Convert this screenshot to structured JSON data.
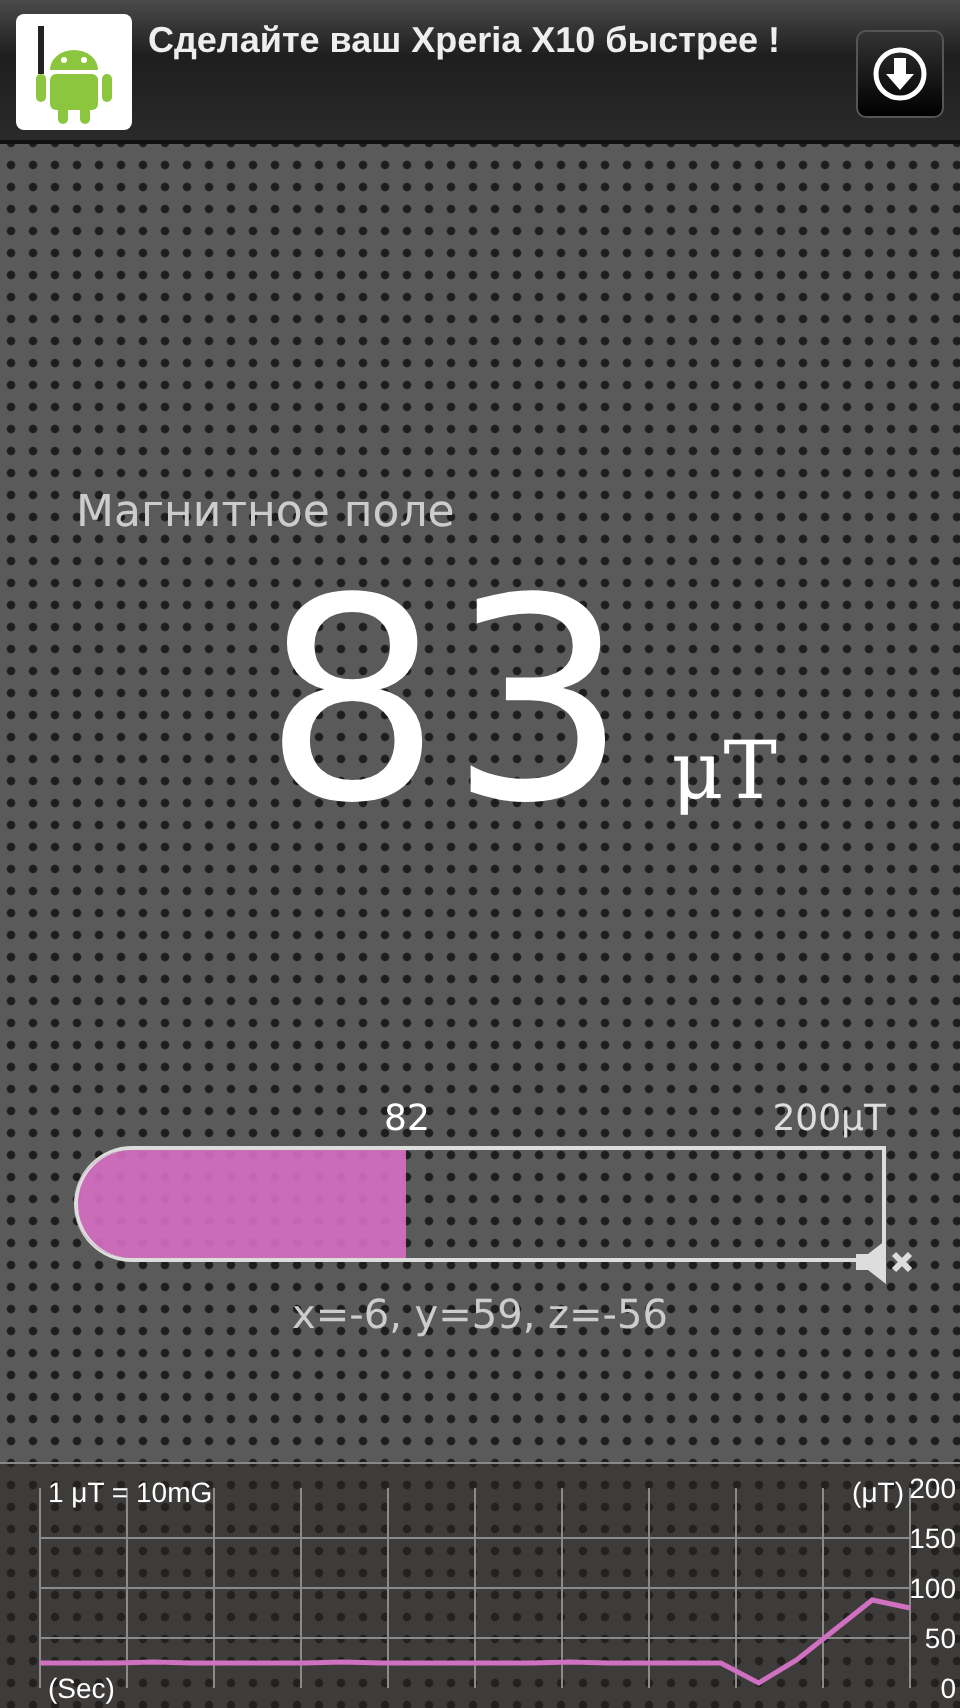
{
  "ad": {
    "title": "Сделайте ваш Xperia X10 быстрее !"
  },
  "reading": {
    "label": "Магнитное поле",
    "value": "83",
    "unit": "μT"
  },
  "meter": {
    "current": "82",
    "max": "200μT",
    "level": 0.41
  },
  "axes": {
    "text": "x=-6, y=59, z=-56"
  },
  "history": {
    "note": "1 μT = 10mG",
    "chart_data": {
      "type": "line",
      "grid": true,
      "xlabel": "(Sec)",
      "ylabel": "(μT)",
      "categories": [
        null,
        null,
        null,
        null,
        null,
        null,
        null,
        null,
        null,
        null,
        null,
        null,
        null,
        null,
        null,
        null,
        null,
        null,
        null,
        null,
        null,
        null,
        null,
        null
      ],
      "ylim": [
        0,
        200
      ],
      "yticks": [
        0,
        50,
        100,
        150,
        200
      ],
      "series": [
        {
          "color": "#d070c0",
          "values": [
            25,
            25,
            25,
            26,
            25,
            25,
            25,
            25,
            26,
            25,
            25,
            25,
            25,
            25,
            26,
            25,
            25,
            25,
            25,
            5,
            28,
            58,
            88,
            80
          ]
        }
      ]
    }
  }
}
